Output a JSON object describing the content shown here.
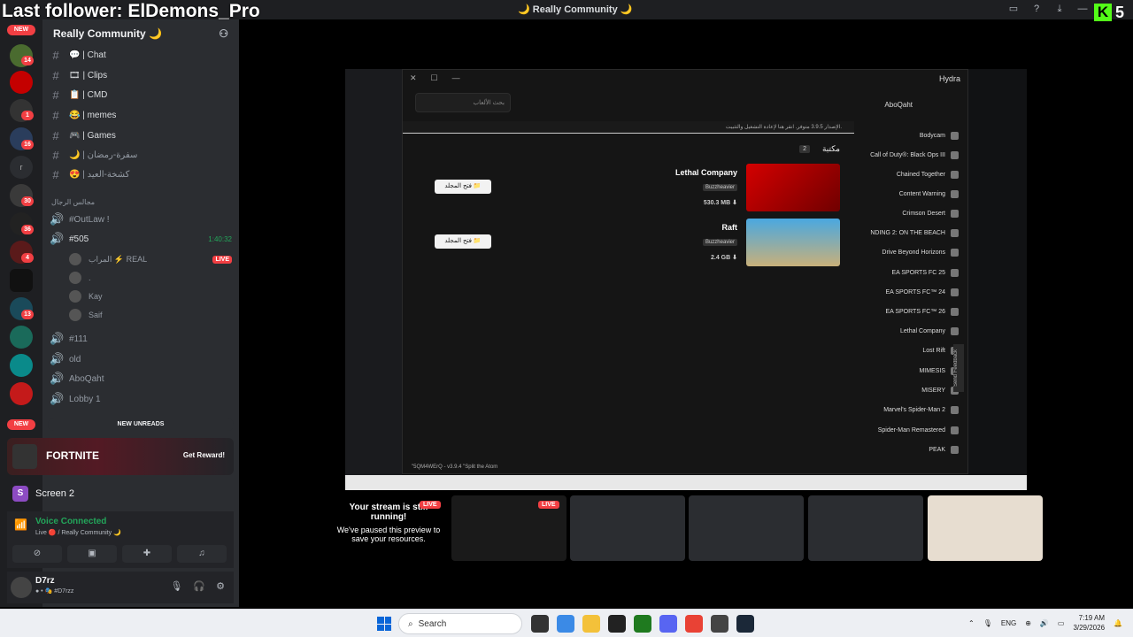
{
  "overlay": {
    "follower": "Last follower: ElDemons_Pro",
    "kick_letter": "K",
    "kick_count": "5"
  },
  "titlebar": {
    "server_title": "🌙 Really Community 🌙"
  },
  "rail": {
    "new_top": "NEW",
    "new_bottom": "NEW",
    "badges": [
      "14",
      "1",
      "16",
      "30",
      "36",
      "4",
      "13"
    ]
  },
  "sidebar": {
    "server_name": "Really Community 🌙",
    "channels": [
      {
        "icon": "#",
        "label": "💬 | Chat"
      },
      {
        "icon": "#",
        "label": "🎞 | Clips"
      },
      {
        "icon": "#",
        "label": "📋 | CMD"
      },
      {
        "icon": "#",
        "label": "😂 | memes"
      },
      {
        "icon": "#",
        "label": "🎮 | Games"
      },
      {
        "icon": "#",
        "label": "🌙 | سفرة-رمضان"
      },
      {
        "icon": "#",
        "label": "😍 | كشخة-العيد"
      }
    ],
    "category": "مجالس الرجال",
    "voice_channels": [
      {
        "label": "#OutLaw !"
      },
      {
        "label": "#505",
        "time": "1:40:32"
      }
    ],
    "voice_users": [
      {
        "name": "المراب ⚡ REAL",
        "live": "LIVE"
      },
      {
        "name": "."
      },
      {
        "name": "Kay"
      },
      {
        "name": "Saif"
      }
    ],
    "more_channels": [
      "#111",
      "old",
      "AboQaht",
      "Lobby 1"
    ],
    "new_unreads": "NEW UNREADS"
  },
  "fortnite": {
    "name": "FORTNITE",
    "reward": "Get Reward!"
  },
  "screen_row": {
    "avatar": "S",
    "label": "Screen 2"
  },
  "voice": {
    "status": "Voice Connected",
    "sub": "Live 🔴 / Really Community 🌙"
  },
  "user": {
    "name": "D7rz",
    "status": "● • 🎭 #D7rzz"
  },
  "hydra": {
    "title": "Hydra",
    "search_placeholder": "بحث الألعاب",
    "username": "AboQaht",
    "notice": "الإصدار 3.9.5 متوفر. انقر هنا لإعادة التشغيل والتثبيت.",
    "library_header": "مكتبة",
    "library_count": "2",
    "games": [
      {
        "name": "Lethal Company",
        "source": "Buzzheavier",
        "size": "530.3 MB ⬇",
        "button": "فتح المجلد 📁"
      },
      {
        "name": "Raft",
        "source": "Buzzheavier",
        "size": "2.4 GB ⬇",
        "button": "فتح المجلد 📁"
      }
    ],
    "list": [
      "Bodycam",
      "Call of Duty®: Black Ops III",
      "Chained Together",
      "Content Warning",
      "Crimson Desert",
      "NDING 2: ON THE BEACH",
      "Drive Beyond Horizons",
      "EA SPORTS FC 25",
      "EA SPORTS FC™ 24",
      "EA SPORTS FC™ 26",
      "Lethal Company",
      "Lost Rift",
      "MIMESIS",
      "MISERY",
      "Marvel's Spider-Man 2",
      "Spider-Man Remastered",
      "PEAK"
    ],
    "feedback": "Send Feedback",
    "status": "\"5QM4WErQ - v3.9.4 \"Split the Atom"
  },
  "stream_preview": {
    "paused_title": "Your stream is still running!",
    "paused_body": "We've paused this preview to save your resources.",
    "live": "LIVE"
  },
  "taskbar": {
    "search": "Search",
    "lang": "ENG",
    "time": "7:19 AM",
    "date": "3/29/2026"
  }
}
